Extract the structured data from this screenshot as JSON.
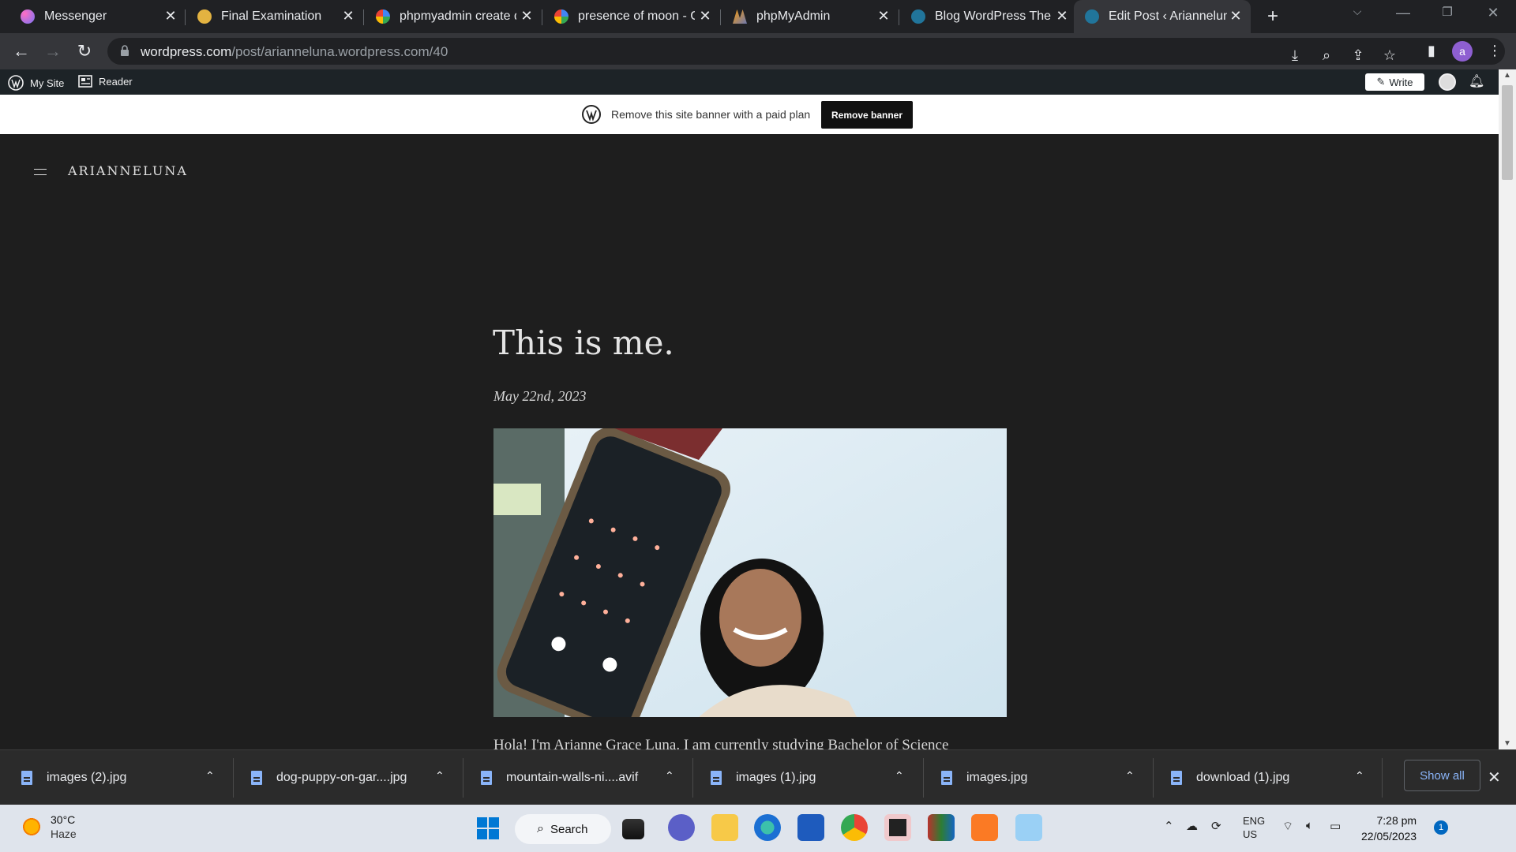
{
  "browser": {
    "tabs": [
      {
        "title": "Messenger",
        "icon": "messenger-icon",
        "active": false
      },
      {
        "title": "Final Examination",
        "icon": "exam-icon",
        "active": false
      },
      {
        "title": "phpmyadmin create d",
        "icon": "google-icon",
        "active": false
      },
      {
        "title": "presence of moon - G",
        "icon": "google-icon",
        "active": false
      },
      {
        "title": "phpMyAdmin",
        "icon": "phpmyadmin-icon",
        "active": false
      },
      {
        "title": "Blog WordPress Them",
        "icon": "wordpress-icon",
        "active": false
      },
      {
        "title": "Edit Post ‹ Ariannelun",
        "icon": "wordpress-icon",
        "active": true
      }
    ],
    "url_host": "wordpress.com",
    "url_path": "/post/arianneluna.wordpress.com/40",
    "profile_initial": "a"
  },
  "wp_admin_bar": {
    "my_site": "My Site",
    "reader": "Reader",
    "write": "Write"
  },
  "banner": {
    "text": "Remove this site banner with a paid plan",
    "button": "Remove banner"
  },
  "site": {
    "name": "ARIANNELUNA"
  },
  "post": {
    "title": "This is me.",
    "date": "May 22nd, 2023",
    "body_start": "Hola! I'm Arianne Grace Luna. I am currently studying Bachelor of Science"
  },
  "downloads": {
    "items": [
      {
        "name": "images (2).jpg"
      },
      {
        "name": "dog-puppy-on-gar....jpg"
      },
      {
        "name": "mountain-walls-ni....avif"
      },
      {
        "name": "images (1).jpg"
      },
      {
        "name": "images.jpg"
      },
      {
        "name": "download (1).jpg"
      }
    ],
    "show_all": "Show all"
  },
  "taskbar": {
    "weather_temp": "30°C",
    "weather_cond": "Haze",
    "search": "Search",
    "lang_top": "ENG",
    "lang_bottom": "US",
    "time": "7:28 pm",
    "date": "22/05/2023",
    "notifications": "1"
  },
  "colors": {
    "page_bg": "#1e1e1e",
    "tab_strip": "#202124",
    "toolbar": "#35363a",
    "wp_bar": "#1d2327",
    "link_blue": "#8ab4f8"
  }
}
